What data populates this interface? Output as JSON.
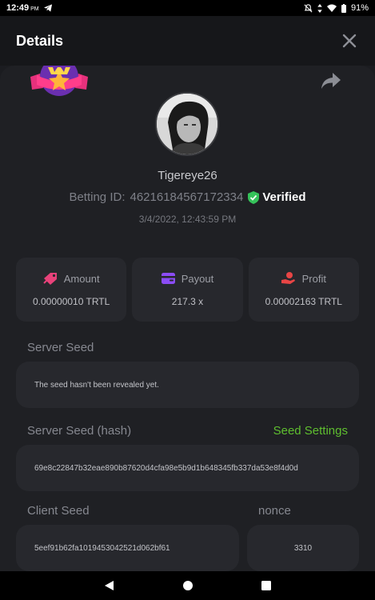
{
  "status_bar": {
    "time": "12:49",
    "ampm": "PM",
    "battery": "91%"
  },
  "header": {
    "title": "Details"
  },
  "profile": {
    "username": "Tigereye26",
    "betting_id_label": "Betting ID:",
    "betting_id": "46216184567172334",
    "verified_label": "Verified",
    "date": "3/4/2022, 12:43:59 PM"
  },
  "stats": {
    "amount": {
      "label": "Amount",
      "value": "0.00000010 TRTL"
    },
    "payout": {
      "label": "Payout",
      "value": "217.3 x"
    },
    "profit": {
      "label": "Profit",
      "value": "0.00002163 TRTL"
    }
  },
  "server_seed": {
    "label": "Server Seed",
    "value": "The seed hasn't been revealed yet."
  },
  "server_seed_hash": {
    "label": "Server Seed (hash)",
    "link": "Seed Settings",
    "value": "69e8c22847b32eae890b87620d4cfa98e5b9d1b648345fb337da53e8f4d0d"
  },
  "client_seed": {
    "label": "Client Seed",
    "value": "5eef91b62fa1019453042521d062bf61"
  },
  "nonce": {
    "label": "nonce",
    "value": "3310"
  },
  "colors": {
    "accent_green": "#5fbf2f",
    "amount_icon": "#e8427a",
    "payout_icon": "#8b4cf5",
    "profit_icon": "#e84545"
  }
}
